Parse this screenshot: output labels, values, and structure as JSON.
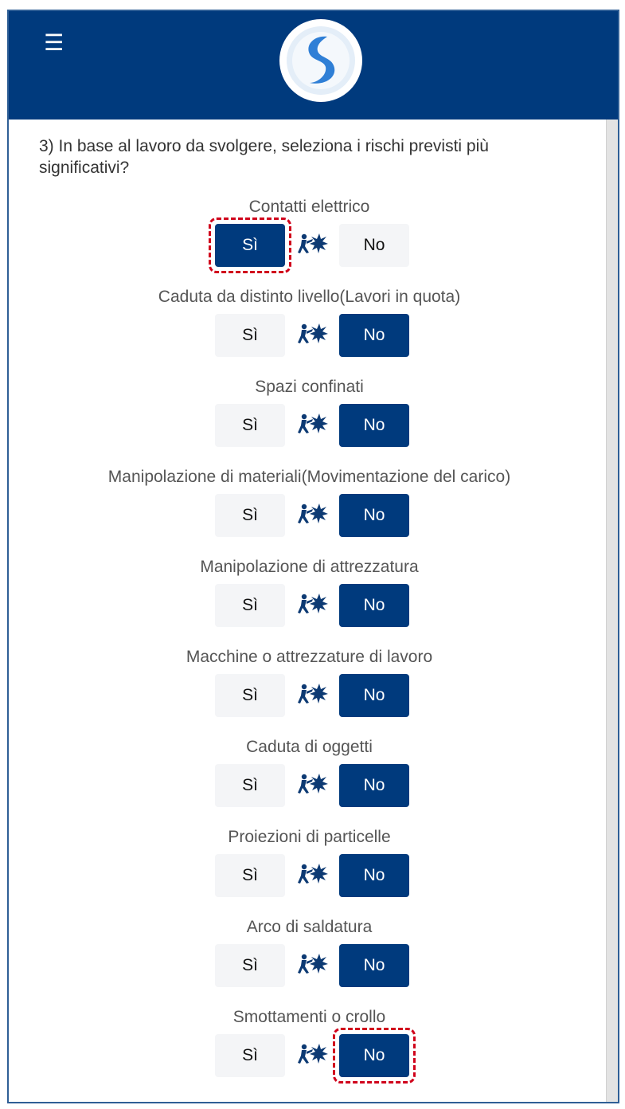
{
  "header": {
    "menu_icon": "hamburger-menu-icon",
    "logo": "app-logo-s"
  },
  "question": "3) In base al lavoro da svolgere, seleziona i rischi previsti più significativi?",
  "options": {
    "yes_label": "Sì",
    "no_label": "No"
  },
  "risk_icon": "electric-hazard-icon",
  "risks": [
    {
      "label": "Contatti elettrico",
      "selected": "si",
      "highlight": "si"
    },
    {
      "label": "Caduta da distinto livello(Lavori in quota)",
      "selected": "no"
    },
    {
      "label": "Spazi confinati",
      "selected": "no"
    },
    {
      "label": "Manipolazione di materiali(Movimentazione del carico)",
      "selected": "no"
    },
    {
      "label": "Manipolazione di attrezzatura",
      "selected": "no"
    },
    {
      "label": "Macchine o attrezzature di lavoro",
      "selected": "no"
    },
    {
      "label": "Caduta di oggetti",
      "selected": "no"
    },
    {
      "label": "Proiezioni di particelle",
      "selected": "no"
    },
    {
      "label": "Arco di saldatura",
      "selected": "no"
    },
    {
      "label": "Smottamenti o crollo",
      "selected": "no",
      "highlight": "no"
    }
  ],
  "colors": {
    "primary": "#003a7d",
    "highlight": "#d0021b",
    "unselected_bg": "#f4f5f7"
  }
}
